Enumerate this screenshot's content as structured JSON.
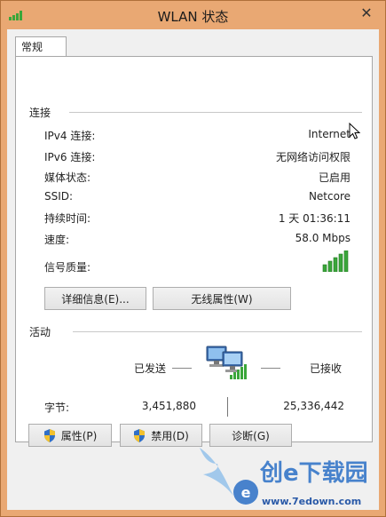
{
  "window": {
    "title": "WLAN 状态",
    "close_glyph": "✕"
  },
  "tab": {
    "label": "常规"
  },
  "connection": {
    "heading": "连接",
    "rows": [
      {
        "label": "IPv4 连接:",
        "value": "Internet"
      },
      {
        "label": "IPv6 连接:",
        "value": "无网络访问权限"
      },
      {
        "label": "媒体状态:",
        "value": "已启用"
      },
      {
        "label": "SSID:",
        "value": "Netcore"
      },
      {
        "label": "持续时间:",
        "value": "1 天 01:36:11"
      },
      {
        "label": "速度:",
        "value": "58.0 Mbps"
      }
    ],
    "signal_label": "信号质量:",
    "signal_bars_active": 5,
    "signal_bars_total": 5
  },
  "buttons": {
    "details": "详细信息(E)...",
    "wireless_props": "无线属性(W)"
  },
  "activity": {
    "heading": "活动",
    "sent_label": "已发送",
    "received_label": "已接收",
    "bytes_label": "字节:",
    "bytes_sent": "3,451,880",
    "bytes_received": "25,336,442"
  },
  "bottom_buttons": {
    "properties": "属性(P)",
    "disable": "禁用(D)",
    "diagnose": "诊断(G)"
  },
  "watermark": {
    "text": "创e下载园",
    "url": "www.7edown.com"
  },
  "icons": {
    "title": "wifi-signal-icon",
    "close": "close-icon",
    "signal": "signal-strength-icon",
    "network": "network-computers-icon",
    "shield": "uac-shield-icon",
    "cursor": "mouse-cursor-icon"
  },
  "colors": {
    "frame": "#e9a873",
    "signal": "#3aa63a",
    "panel": "#ffffff",
    "button_border": "#adadad"
  }
}
